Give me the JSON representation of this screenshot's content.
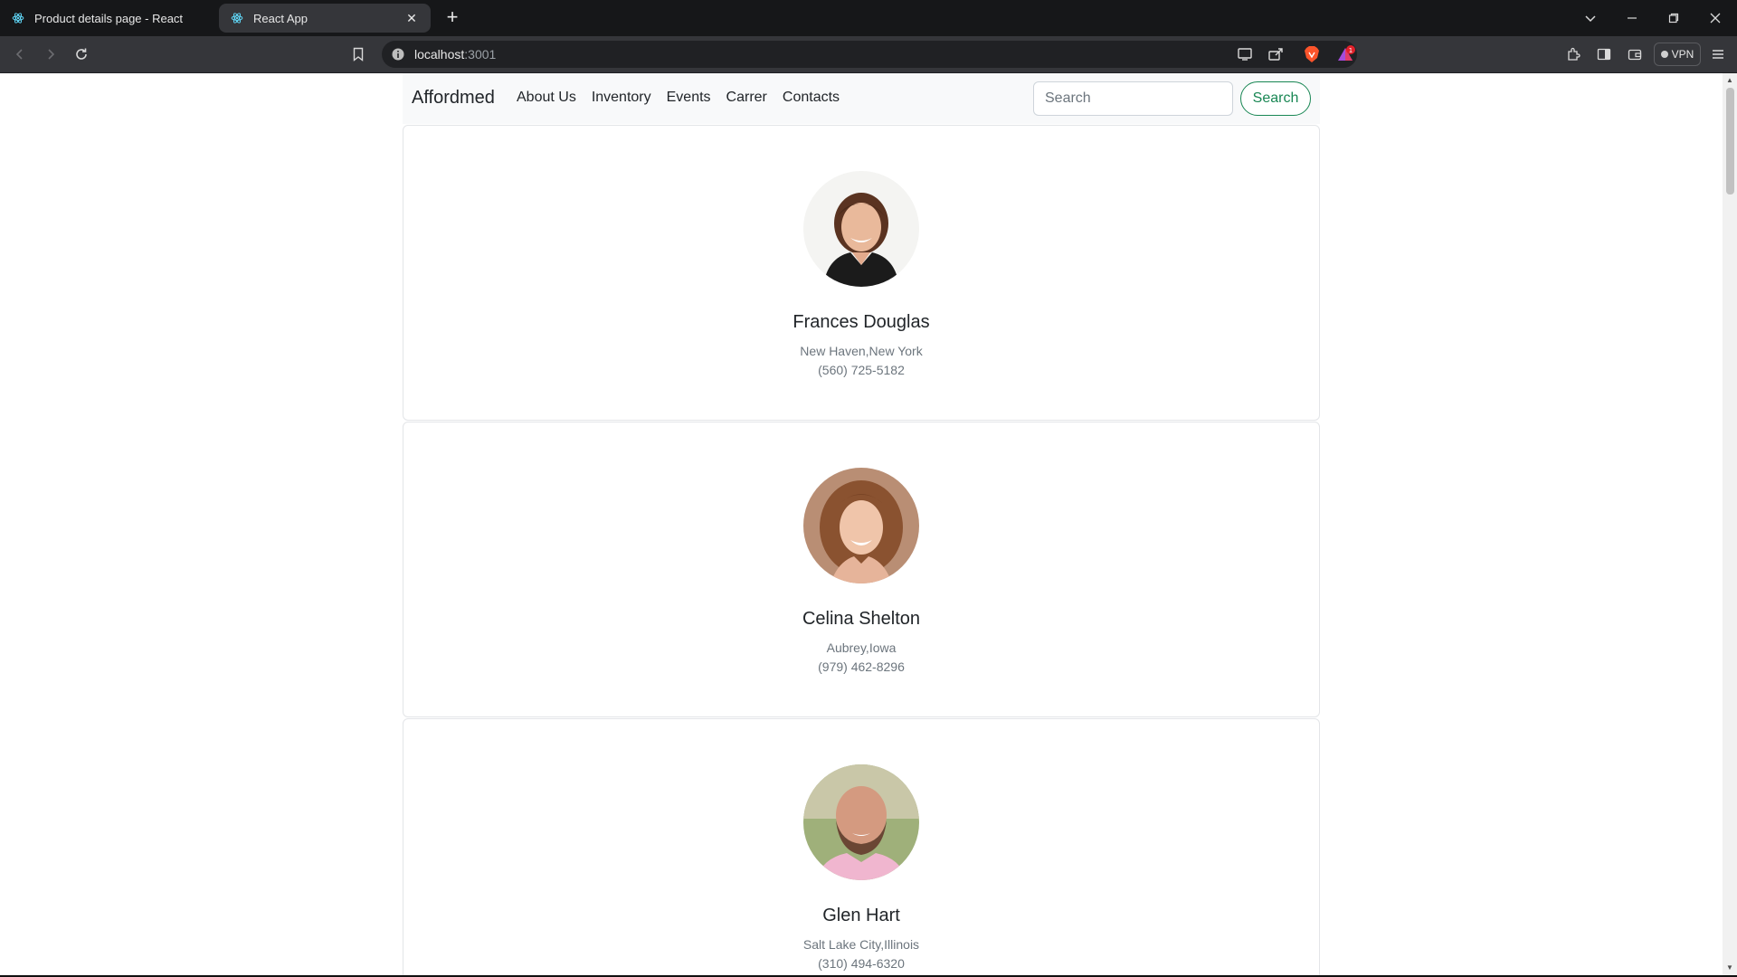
{
  "browser": {
    "tabs": [
      {
        "title": "Product details page - React",
        "active": false
      },
      {
        "title": "React App",
        "active": true
      }
    ],
    "url_host": "localhost",
    "url_port": ":3001",
    "vpn_label": "VPN"
  },
  "navbar": {
    "brand": "Affordmed",
    "links": [
      "About Us",
      "Inventory",
      "Events",
      "Carrer",
      "Contacts"
    ],
    "search_placeholder": "Search",
    "search_button": "Search"
  },
  "people": [
    {
      "name": "Frances Douglas",
      "location": "New Haven,New York",
      "phone": "(560) 725-5182"
    },
    {
      "name": "Celina Shelton",
      "location": "Aubrey,Iowa",
      "phone": "(979) 462-8296"
    },
    {
      "name": "Glen Hart",
      "location": "Salt Lake City,Illinois",
      "phone": "(310) 494-6320"
    }
  ],
  "colors": {
    "brand_green": "#198754",
    "navbar_bg": "#f8f9fa",
    "muted_text": "#6c757d"
  }
}
